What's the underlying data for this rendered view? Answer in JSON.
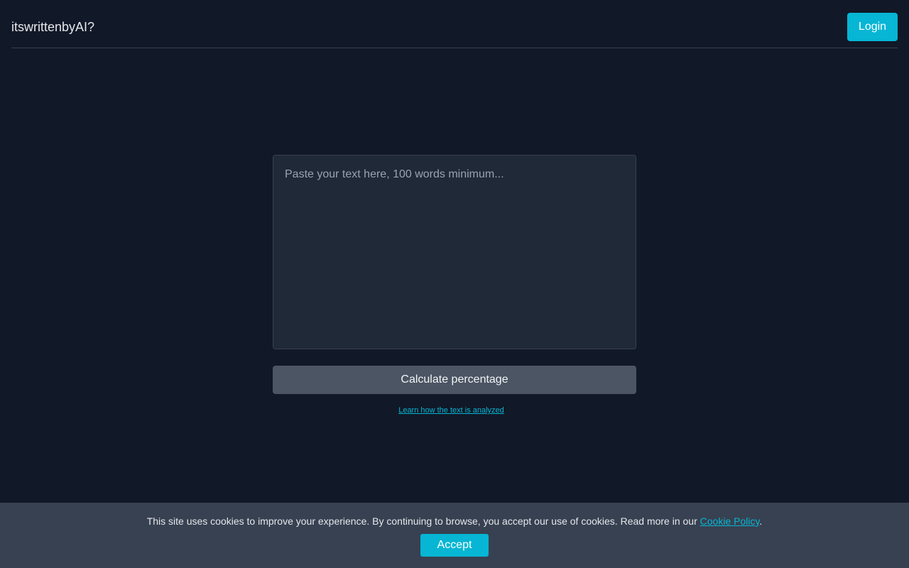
{
  "header": {
    "brand": "itswrittenbyAI?",
    "login_label": "Login"
  },
  "main": {
    "textarea": {
      "value": "",
      "placeholder": "Paste your text here, 100 words minimum..."
    },
    "calculate_label": "Calculate percentage",
    "learn_link": "Learn how the text is analyzed"
  },
  "cookie_banner": {
    "text_before": "This site uses cookies to improve your experience. By continuing to browse, you accept our use of cookies. Read more in our ",
    "policy_link": "Cookie Policy",
    "text_after": ".",
    "accept_label": "Accept"
  },
  "colors": {
    "background": "#111827",
    "accent": "#06b6d4",
    "panel": "#1f2937",
    "cookie_bar": "#374151",
    "secondary_button": "#4b5563"
  }
}
